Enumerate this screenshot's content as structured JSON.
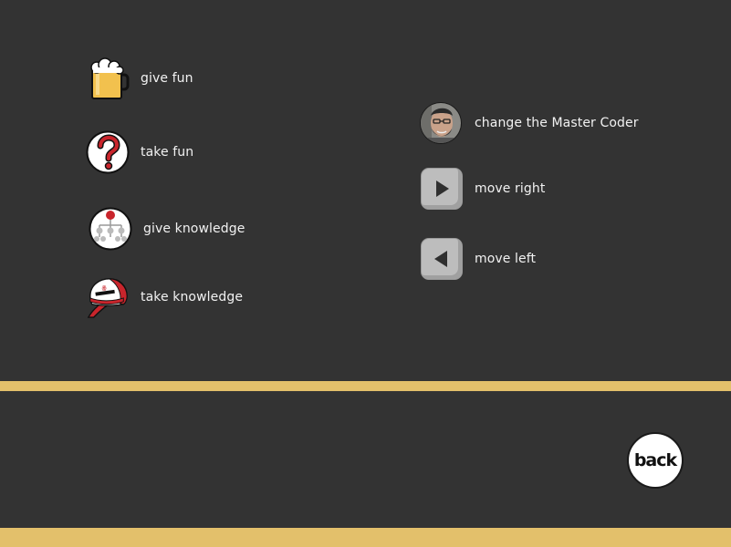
{
  "controls": {
    "give_fun": "give fun",
    "take_fun": "take fun",
    "give_knowledge": "give knowledge",
    "take_knowledge": "take knowledge",
    "change_master_coder": "change the Master Coder",
    "move_right": "move right",
    "move_left": "move left"
  },
  "back_label": "back",
  "colors": {
    "background": "#333333",
    "stripe": "#e3c06b",
    "beer": "#f2c14e",
    "hat_red": "#c9252c"
  },
  "icons": {
    "give_fun": "beer-mug-icon",
    "take_fun": "question-mark-icon",
    "give_knowledge": "org-chart-icon",
    "take_knowledge": "cap-icon",
    "change_master_coder": "coder-avatar-icon",
    "move_right": "arrow-right-icon",
    "move_left": "arrow-left-icon"
  }
}
